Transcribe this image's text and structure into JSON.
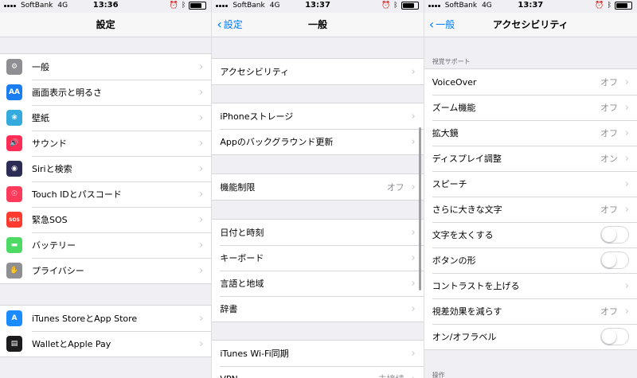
{
  "status": {
    "carrier": "SoftBank",
    "network": "4G",
    "times": [
      "13:36",
      "13:37",
      "13:37"
    ]
  },
  "screen1": {
    "title": "設定",
    "group1": [
      {
        "label": "一般",
        "icon": "gear-icon",
        "color": "#8e8e93",
        "glyph": "⚙"
      },
      {
        "label": "画面表示と明るさ",
        "icon": "display-aa-icon",
        "color": "#1a7df0",
        "glyph": "AA"
      },
      {
        "label": "壁紙",
        "icon": "wallpaper-flower-icon",
        "color": "#35aadc",
        "glyph": "❀"
      },
      {
        "label": "サウンド",
        "icon": "speaker-icon",
        "color": "#ff2d55",
        "glyph": "🔊"
      },
      {
        "label": "Siriと検索",
        "icon": "siri-icon",
        "color": "#2c2c54",
        "glyph": "◉"
      },
      {
        "label": "Touch IDとパスコード",
        "icon": "fingerprint-icon",
        "color": "#ff3b5c",
        "glyph": "☉"
      },
      {
        "label": "緊急SOS",
        "icon": "sos-icon",
        "color": "#ff3b30",
        "glyph": "SOS"
      },
      {
        "label": "バッテリー",
        "icon": "battery-icon",
        "color": "#4cd964",
        "glyph": "▬"
      },
      {
        "label": "プライバシー",
        "icon": "hand-icon",
        "color": "#8e8e93",
        "glyph": "✋"
      }
    ],
    "group2": [
      {
        "label": "iTunes StoreとApp Store",
        "icon": "app-store-icon",
        "color": "#1a8cff",
        "glyph": "A"
      },
      {
        "label": "WalletとApple Pay",
        "icon": "wallet-icon",
        "color": "#1c1c1e",
        "glyph": "▤"
      }
    ]
  },
  "screen2": {
    "back": "設定",
    "title": "一般",
    "groups": [
      [
        {
          "label": "アクセシビリティ"
        }
      ],
      [
        {
          "label": "iPhoneストレージ"
        },
        {
          "label": "Appのバックグラウンド更新"
        }
      ],
      [
        {
          "label": "機能制限",
          "value": "オフ"
        }
      ],
      [
        {
          "label": "日付と時刻"
        },
        {
          "label": "キーボード"
        },
        {
          "label": "言語と地域"
        },
        {
          "label": "辞書"
        }
      ],
      [
        {
          "label": "iTunes Wi-Fi同期"
        },
        {
          "label": "VPN",
          "value": "未接続"
        }
      ]
    ]
  },
  "screen3": {
    "back": "一般",
    "title": "アクセシビリティ",
    "section1_header": "視覚サポート",
    "rows": [
      {
        "label": "VoiceOver",
        "value": "オフ",
        "type": "chevron"
      },
      {
        "label": "ズーム機能",
        "value": "オフ",
        "type": "chevron"
      },
      {
        "label": "拡大鏡",
        "value": "オフ",
        "type": "chevron"
      },
      {
        "label": "ディスプレイ調整",
        "value": "オン",
        "type": "chevron"
      },
      {
        "label": "スピーチ",
        "value": "",
        "type": "chevron"
      },
      {
        "label": "さらに大きな文字",
        "value": "オフ",
        "type": "chevron"
      },
      {
        "label": "文字を太くする",
        "type": "toggle",
        "on": false
      },
      {
        "label": "ボタンの形",
        "type": "toggle",
        "on": false
      },
      {
        "label": "コントラストを上げる",
        "value": "",
        "type": "chevron"
      },
      {
        "label": "視差効果を減らす",
        "value": "オフ",
        "type": "chevron"
      },
      {
        "label": "オン/オフラベル",
        "type": "toggle",
        "on": false
      }
    ],
    "section2_header": "操作"
  }
}
